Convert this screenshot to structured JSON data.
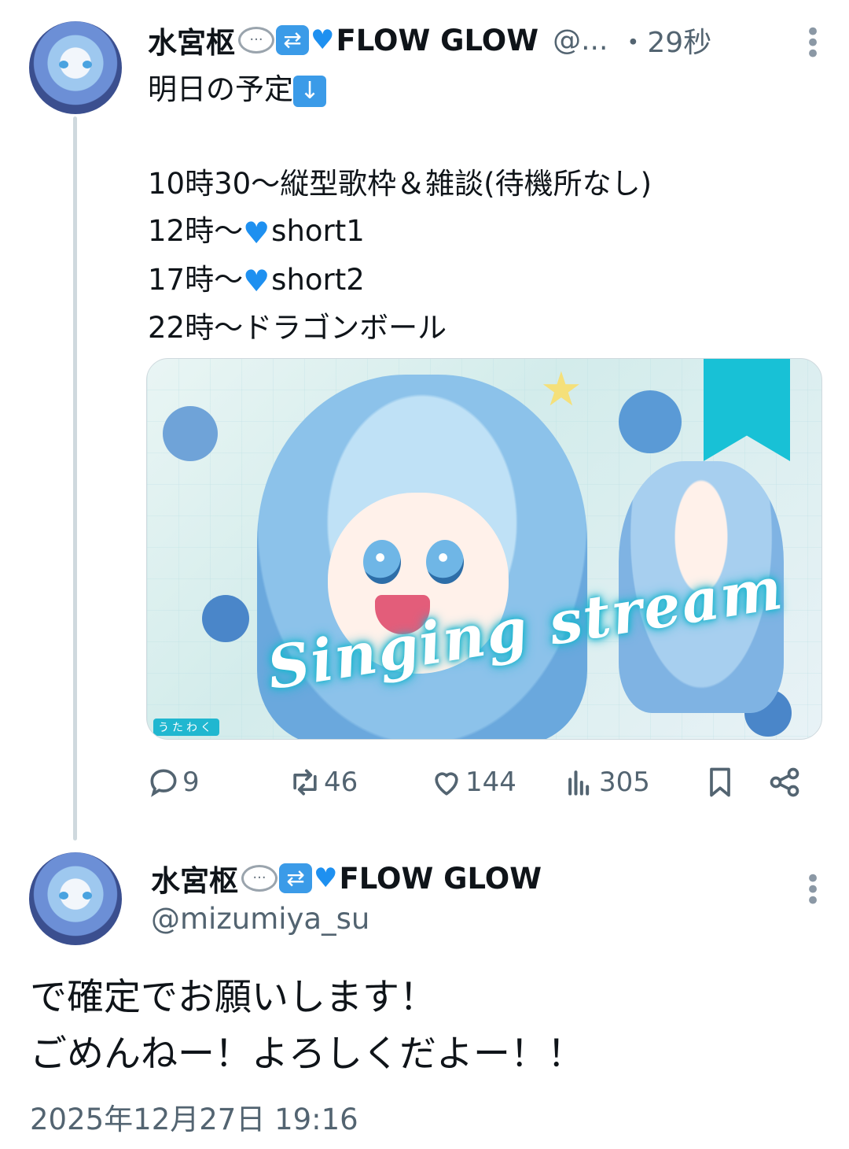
{
  "tweet1": {
    "display_name": "水宮枢",
    "name_suffix": "FLOW GLOW",
    "handle_short": "@...",
    "time": "・29秒",
    "lines": [
      "明日の予定",
      "",
      "10時30～縦型歌枠＆雑談(待機所なし)",
      "12時～",
      "17時～",
      "22時～ドラゴンボール"
    ],
    "line4_suffix": "short1",
    "line5_suffix": "short2",
    "media": {
      "caption": "Singing stream",
      "tag": "うたわく"
    },
    "stats": {
      "replies": "9",
      "retweets": "46",
      "likes": "144",
      "views": "305"
    }
  },
  "tweet2": {
    "display_name": "水宮枢",
    "name_suffix": "FLOW GLOW",
    "handle": "@mizumiya_su",
    "body_line1": "で確定でお願いします！",
    "body_line2": "ごめんねー！よろしくだよー！！",
    "timestamp": "2025年12月27日 19:16"
  },
  "icons": {
    "reply": "reply-icon",
    "retweet": "retweet-icon",
    "like": "heart-icon",
    "views": "views-icon",
    "bookmark": "bookmark-icon",
    "share": "share-icon",
    "more": "more-vertical-icon"
  },
  "colors": {
    "text": "#0f1419",
    "secondary": "#536471",
    "thread_line": "#cfd9de",
    "emoji_blue": "#3b9be8"
  }
}
